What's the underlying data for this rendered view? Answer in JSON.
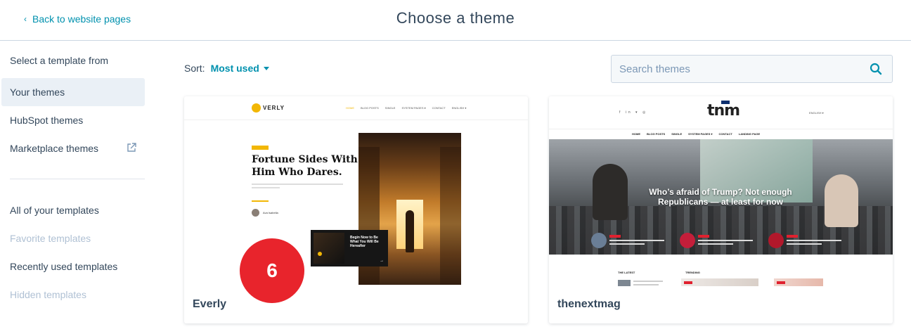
{
  "header": {
    "back_label": "Back to website pages",
    "title": "Choose a theme"
  },
  "sidebar": {
    "heading": "Select a template from",
    "sources": [
      {
        "label": "Your themes",
        "active": true
      },
      {
        "label": "HubSpot themes"
      },
      {
        "label": "Marketplace themes",
        "icon": "external-link-icon"
      }
    ],
    "filters": [
      {
        "label": "All of your templates",
        "enabled": true
      },
      {
        "label": "Favorite templates",
        "enabled": false
      },
      {
        "label": "Recently used templates",
        "enabled": true
      },
      {
        "label": "Hidden templates",
        "enabled": false
      }
    ]
  },
  "toolbar": {
    "sort_label": "Sort:",
    "sort_value": "Most used",
    "search_placeholder": "Search themes"
  },
  "themes": [
    {
      "name": "Everly",
      "preview": {
        "logo": "VERLY",
        "nav": [
          "HOME",
          "BLOG POSTS",
          "SINGLE",
          "SYSTEM PAGES ▾",
          "CONTACT",
          "ENGLISH ▾"
        ],
        "headline": "Fortune Sides With Him Who Dares.",
        "author": "Ava Isabella",
        "promo_title": "Begin Now to Be What You Will Be Hereafter"
      },
      "badge": "6"
    },
    {
      "name": "thenextmag",
      "preview": {
        "logo": "tnm",
        "language": "ENGLISH ▾",
        "social": "f in ▾ ◎",
        "nav": [
          "HOME",
          "BLOG POSTS",
          "SINGLE",
          "SYSTEM PAGES ▾",
          "CONTACT",
          "LANDING PAGE"
        ],
        "headline": "Who’s afraid of Trump? Not enough Republicans — at least for now",
        "section_latest": "THE LATEST",
        "section_trending": "TRENDING"
      }
    }
  ],
  "colors": {
    "accent": "#0091ae",
    "text": "#33475b",
    "badge": "#e8242c"
  }
}
